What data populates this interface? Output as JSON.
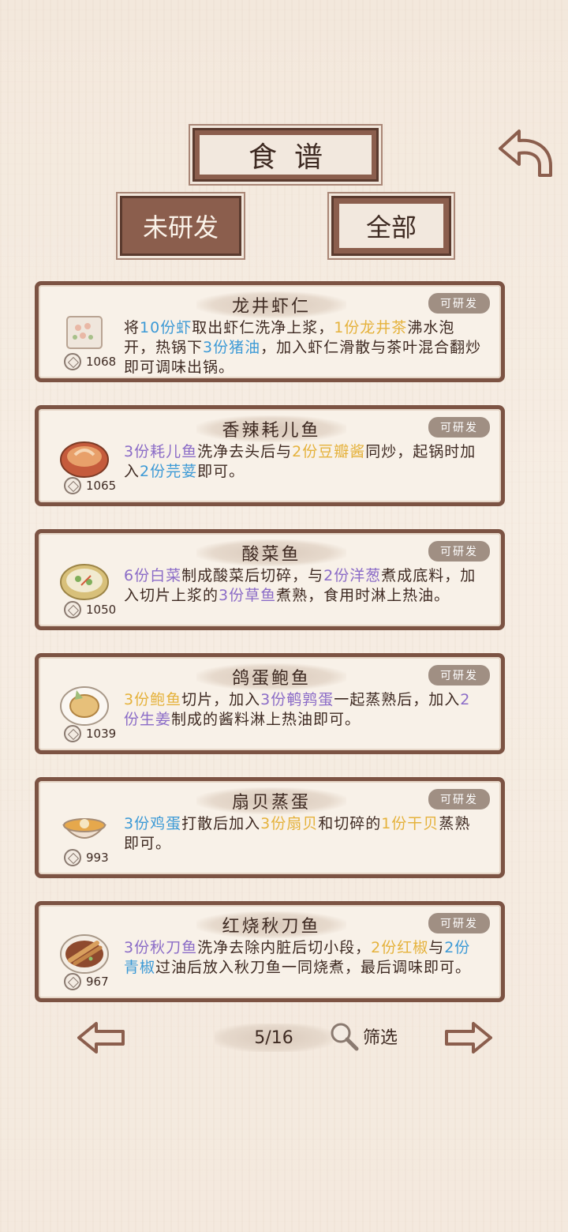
{
  "header": {
    "title": "食谱"
  },
  "tabs": [
    {
      "label": "未研发"
    },
    {
      "label": "全部"
    }
  ],
  "recipes": [
    {
      "name": "龙井虾仁",
      "badge": "可研发",
      "cost": "1068",
      "dish_icon": "shrimp-dish-icon",
      "desc": [
        {
          "t": "将"
        },
        {
          "t": "10份虾",
          "c": "blue"
        },
        {
          "t": "取出虾仁洗净上浆，"
        },
        {
          "t": "1份龙井茶",
          "c": "gold"
        },
        {
          "t": "沸水泡开，热锅下"
        },
        {
          "t": "3份猪油",
          "c": "blue"
        },
        {
          "t": "，加入虾仁滑散与茶叶混合翻炒即可调味出锅。"
        }
      ]
    },
    {
      "name": "香辣耗儿鱼",
      "badge": "可研发",
      "cost": "1065",
      "dish_icon": "spicy-fish-pot-icon",
      "desc": [
        {
          "t": "3份耗儿鱼",
          "c": "purple"
        },
        {
          "t": "洗净去头后与"
        },
        {
          "t": "2份豆瓣酱",
          "c": "gold"
        },
        {
          "t": "同炒，起锅时加入"
        },
        {
          "t": "2份芫荽",
          "c": "blue"
        },
        {
          "t": "即可。"
        }
      ]
    },
    {
      "name": "酸菜鱼",
      "badge": "可研发",
      "cost": "1050",
      "dish_icon": "pickled-fish-bowl-icon",
      "desc": [
        {
          "t": "6份白菜",
          "c": "purple"
        },
        {
          "t": "制成酸菜后切碎，与"
        },
        {
          "t": "2份洋葱",
          "c": "purple"
        },
        {
          "t": "煮成底料，加入切片上浆的"
        },
        {
          "t": "3份草鱼",
          "c": "purple"
        },
        {
          "t": "煮熟，食用时淋上热油。"
        }
      ]
    },
    {
      "name": "鸽蛋鲍鱼",
      "badge": "可研发",
      "cost": "1039",
      "dish_icon": "abalone-plate-icon",
      "desc": [
        {
          "t": "3份鲍鱼",
          "c": "gold"
        },
        {
          "t": "切片，加入"
        },
        {
          "t": "3份鹌鹑蛋",
          "c": "purple"
        },
        {
          "t": "一起蒸熟后，加入"
        },
        {
          "t": "2份生姜",
          "c": "purple"
        },
        {
          "t": "制成的酱料淋上热油即可。"
        }
      ]
    },
    {
      "name": "扇贝蒸蛋",
      "badge": "可研发",
      "cost": "993",
      "dish_icon": "steamed-egg-bowl-icon",
      "desc": [
        {
          "t": "3份鸡蛋",
          "c": "blue"
        },
        {
          "t": "打散后加入"
        },
        {
          "t": "3份扇贝",
          "c": "gold"
        },
        {
          "t": "和切碎的"
        },
        {
          "t": "1份干贝",
          "c": "gold"
        },
        {
          "t": "蒸熟即可。"
        }
      ]
    },
    {
      "name": "红烧秋刀鱼",
      "badge": "可研发",
      "cost": "967",
      "dish_icon": "braised-saury-plate-icon",
      "desc": [
        {
          "t": "3份秋刀鱼",
          "c": "purple"
        },
        {
          "t": "洗净去除内脏后切小段，"
        },
        {
          "t": "2份红椒",
          "c": "gold"
        },
        {
          "t": "与"
        },
        {
          "t": "2份青椒",
          "c": "blue"
        },
        {
          "t": "过油后放入秋刀鱼一同烧煮，最后调味即可。"
        }
      ]
    }
  ],
  "footer": {
    "page": "5/16",
    "filter_label": "筛选"
  },
  "colors": {
    "frame": "#7c5343",
    "paper": "#f8f1e8",
    "highlight_blue": "#3d9ad6",
    "highlight_gold": "#e5b23c",
    "highlight_purple": "#8b6cc7"
  }
}
